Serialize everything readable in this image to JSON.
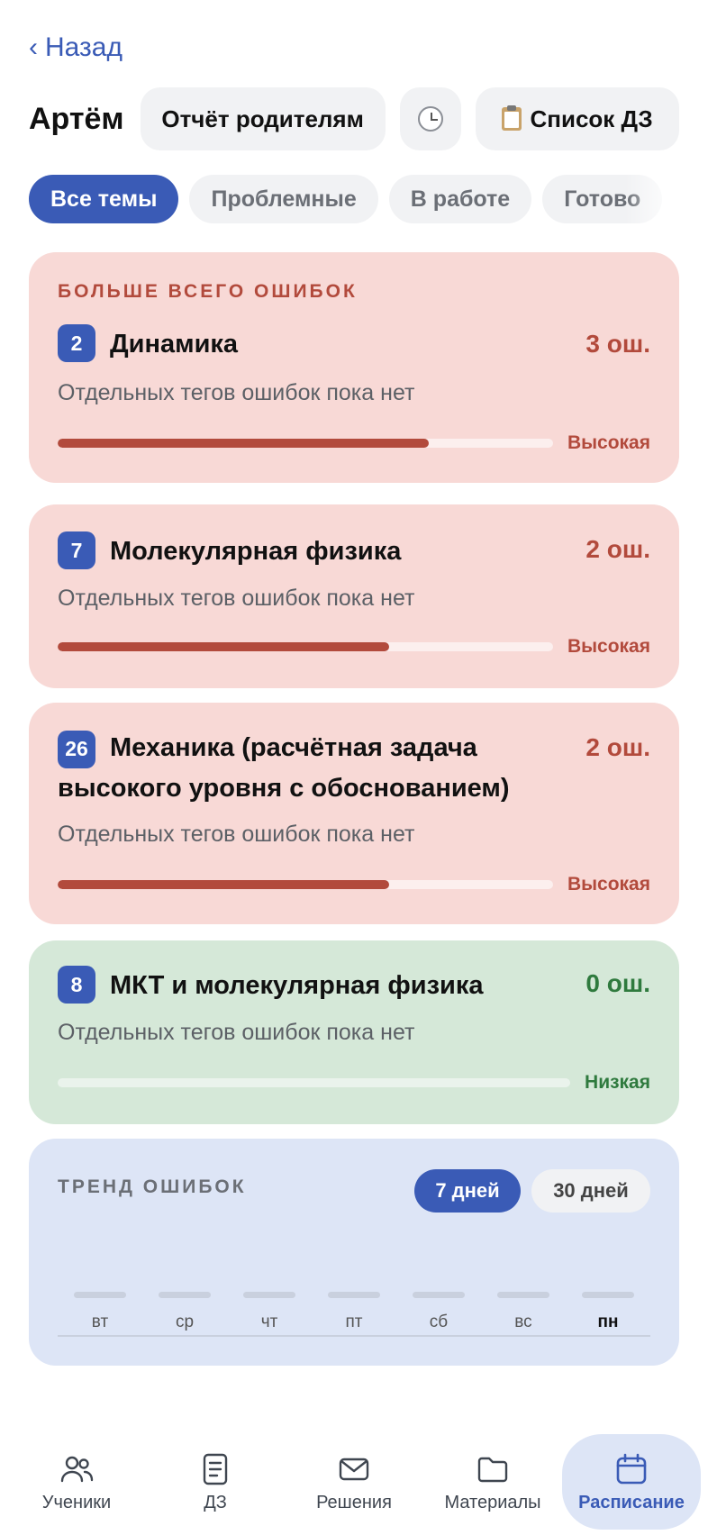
{
  "nav": {
    "back_label": "Назад"
  },
  "header": {
    "student_name": "Артём",
    "report_button": "Отчёт родителям",
    "history_icon": "clock-icon",
    "homework_list_button": "Список ДЗ",
    "homework_list_icon": "clipboard-icon"
  },
  "filters": [
    {
      "label": "Все темы",
      "active": true
    },
    {
      "label": "Проблемные",
      "active": false
    },
    {
      "label": "В работе",
      "active": false
    },
    {
      "label": "Готово",
      "active": false
    }
  ],
  "topics": {
    "caption": "БОЛЬШЕ ВСЕГО ОШИБОК",
    "items": [
      {
        "number": "2",
        "title": "Динамика",
        "errors": "3 ош.",
        "note": "Отдельных тегов ошибок пока нет",
        "priority": "Высокая",
        "level_fraction": 0.75
      },
      {
        "number": "7",
        "title": "Молекулярная физика",
        "errors": "2 ош.",
        "note": "Отдельных тегов ошибок пока нет",
        "priority": "Высокая",
        "level_fraction": 0.67
      },
      {
        "number": "26",
        "title_line1": "Механика (расчётная задача",
        "title_line2": "высокого уровня с обоснованием)",
        "errors": "2 ош.",
        "note": "Отдельных тегов ошибок пока нет",
        "priority": "Высокая",
        "level_fraction": 0.67
      },
      {
        "number": "8",
        "title": "МКТ и молекулярная физика",
        "errors": "0 ош.",
        "note": "Отдельных тегов ошибок пока нет",
        "priority": "Низкая",
        "level_fraction": 0
      }
    ]
  },
  "trend": {
    "title": "ТРЕНД ОШИБОК",
    "period_7": "7 дней",
    "period_30": "30 дней",
    "days": [
      "вт",
      "ср",
      "чт",
      "пт",
      "сб",
      "вс",
      "пн"
    ]
  },
  "tabs": [
    {
      "label": "Ученики",
      "icon": "students-icon"
    },
    {
      "label": "ДЗ",
      "icon": "homework-icon"
    },
    {
      "label": "Решения",
      "icon": "mail-icon"
    },
    {
      "label": "Материалы",
      "icon": "folder-icon"
    },
    {
      "label": "Расписание",
      "icon": "calendar-icon",
      "active": true
    }
  ],
  "colors": {
    "accent": "#3a5bb6",
    "danger": "#b24a3c",
    "success": "#2f7a3e"
  }
}
